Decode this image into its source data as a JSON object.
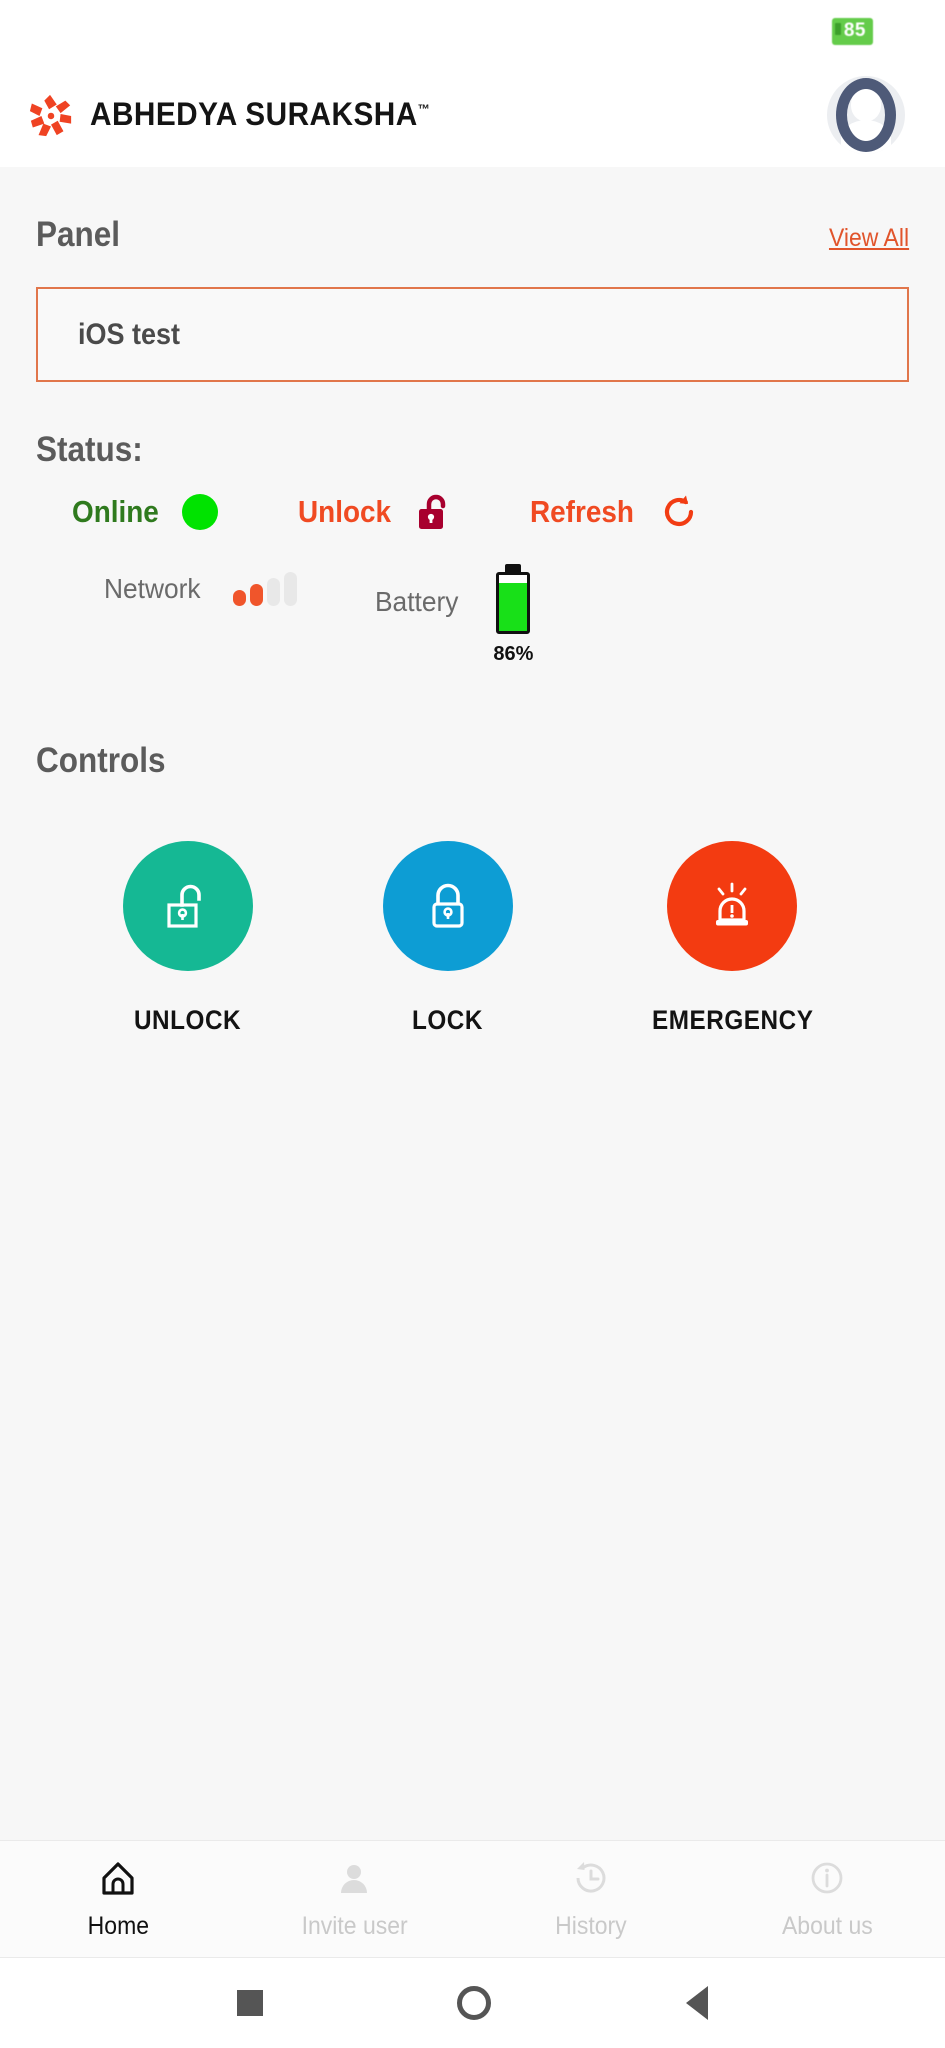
{
  "statusbar": {
    "battery_badge": "85"
  },
  "header": {
    "brand_name": "ABHEDYA SURAKSHA",
    "trademark": "™",
    "logo_icon": "starburst-logo-icon",
    "avatar_icon": "user-avatar-icon"
  },
  "panel": {
    "title": "Panel",
    "view_all": "View All",
    "selected_device": "iOS test"
  },
  "status": {
    "title": "Status:",
    "connection": {
      "label": "Online",
      "indicator": "green-dot-icon",
      "color": "#2f7a1e"
    },
    "lock_state": {
      "label": "Unlock",
      "indicator": "open-padlock-icon",
      "color": "#f04a22"
    },
    "refresh": {
      "label": "Refresh",
      "indicator": "refresh-icon",
      "color": "#f04a22"
    },
    "network": {
      "label": "Network",
      "bars_total": 4,
      "bars_active": 2
    },
    "battery": {
      "label": "Battery",
      "percent_text": "86%",
      "percent": 86
    }
  },
  "controls": {
    "title": "Controls",
    "buttons": [
      {
        "label": "UNLOCK",
        "icon": "open-padlock-icon",
        "color": "#15b894"
      },
      {
        "label": "LOCK",
        "icon": "closed-padlock-icon",
        "color": "#0d9dd4"
      },
      {
        "label": "EMERGENCY",
        "icon": "siren-alarm-icon",
        "color": "#f33b11"
      }
    ]
  },
  "bottom_nav": {
    "items": [
      {
        "label": "Home",
        "icon": "home-icon",
        "active": true
      },
      {
        "label": "Invite user",
        "icon": "person-icon",
        "active": false
      },
      {
        "label": "History",
        "icon": "clock-history-icon",
        "active": false
      },
      {
        "label": "About us",
        "icon": "info-circle-icon",
        "active": false
      }
    ]
  },
  "system_nav": {
    "items": [
      {
        "icon": "square-recents-icon"
      },
      {
        "icon": "circle-home-icon"
      },
      {
        "icon": "triangle-back-icon"
      }
    ]
  }
}
